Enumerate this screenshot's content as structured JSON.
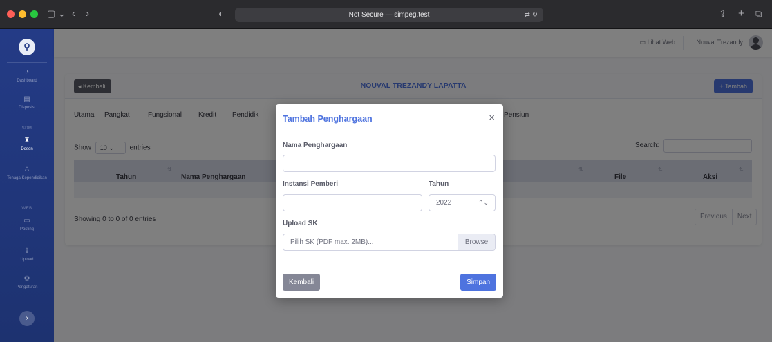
{
  "browser": {
    "url_text": "Not Secure — simpeg.test",
    "controls": {
      "sidebar": "▢ ⌄",
      "back": "‹",
      "forward": "›",
      "shield": "◐",
      "translate": "⇄ ↻",
      "share": "⇪",
      "new_tab": "+",
      "tabs": "⧉"
    },
    "traffic_colors": [
      "#ff5f57",
      "#febc2e",
      "#28c840"
    ]
  },
  "sidebar": {
    "logo": "⚲",
    "items": [
      {
        "label": "Dashboard",
        "icon": "◔"
      },
      {
        "label": "Disposisi",
        "icon": "▤"
      },
      {
        "label": "Dosen",
        "icon": "♜"
      },
      {
        "label": "Tenaga Kependidikan",
        "icon": "♙"
      },
      {
        "label": "Posting",
        "icon": "▭"
      },
      {
        "label": "Upload",
        "icon": "⇪"
      },
      {
        "label": "Pengaturan",
        "icon": "⚙"
      }
    ],
    "headings": [
      "SDM",
      "WEB"
    ],
    "toggle": "›"
  },
  "topbar": {
    "lihat_web": "Lihat Web",
    "user_name": "Nouval Trezandy"
  },
  "card": {
    "back_label": "Kembali",
    "title": "NOUVAL TREZANDY LAPATTA",
    "add_label": "Tambah",
    "tabs": [
      "Utama",
      "Pangkat",
      "Fungsional",
      "Kredit",
      "Pendidik",
      "Pensiun"
    ],
    "show_prefix": "Show",
    "show_value": "10",
    "show_suffix": "entries",
    "search_label": "Search:",
    "columns": [
      "Tahun",
      "Nama Penghargaan",
      "File",
      "Aksi"
    ],
    "showing_text": "Showing 0 to 0 of 0 entries",
    "pager": {
      "previous": "Previous",
      "next": "Next"
    }
  },
  "modal": {
    "title": "Tambah Penghargaan",
    "close": "×",
    "label_nama": "Nama Penghargaan",
    "value_nama": "",
    "label_instansi": "Instansi Pemberi",
    "value_instansi": "",
    "label_tahun": "Tahun",
    "value_tahun": "2022",
    "label_upload": "Upload SK",
    "upload_placeholder": "Pilih SK (PDF max. 2MB)...",
    "browse_label": "Browse",
    "btn_kembali": "Kembali",
    "btn_simpan": "Simpan"
  },
  "colors": {
    "primary": "#4e73df",
    "sidebar": "#243b86",
    "secondary": "#858796"
  }
}
